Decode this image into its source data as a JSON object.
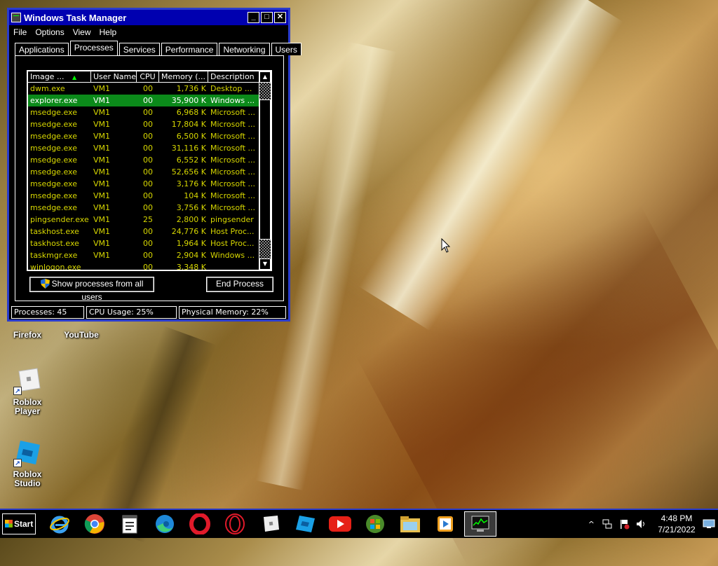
{
  "window": {
    "title": "Windows Task Manager",
    "caption_buttons": {
      "minimize": "_",
      "maximize": "□",
      "close": "✕"
    },
    "menu": [
      "File",
      "Options",
      "View",
      "Help"
    ],
    "tabs": [
      "Applications",
      "Processes",
      "Services",
      "Performance",
      "Networking",
      "Users"
    ],
    "active_tab": "Processes"
  },
  "process_table": {
    "columns": [
      "Image ...",
      "User Name",
      "CPU",
      "Memory (...",
      "Description"
    ],
    "sorted_column": "Image ...",
    "rows": [
      [
        "dwm.exe",
        "VM1",
        "00",
        "1,736 K",
        "Desktop ..."
      ],
      [
        "explorer.exe",
        "VM1",
        "00",
        "35,900 K",
        "Windows ..."
      ],
      [
        "msedge.exe",
        "VM1",
        "00",
        "6,968 K",
        "Microsoft ..."
      ],
      [
        "msedge.exe",
        "VM1",
        "00",
        "17,804 K",
        "Microsoft ..."
      ],
      [
        "msedge.exe",
        "VM1",
        "00",
        "6,500 K",
        "Microsoft ..."
      ],
      [
        "msedge.exe",
        "VM1",
        "00",
        "31,116 K",
        "Microsoft ..."
      ],
      [
        "msedge.exe",
        "VM1",
        "00",
        "6,552 K",
        "Microsoft ..."
      ],
      [
        "msedge.exe",
        "VM1",
        "00",
        "52,656 K",
        "Microsoft ..."
      ],
      [
        "msedge.exe",
        "VM1",
        "00",
        "3,176 K",
        "Microsoft ..."
      ],
      [
        "msedge.exe",
        "VM1",
        "00",
        "104 K",
        "Microsoft ..."
      ],
      [
        "msedge.exe",
        "VM1",
        "00",
        "3,756 K",
        "Microsoft ..."
      ],
      [
        "pingsender.exe",
        "VM1",
        "25",
        "2,800 K",
        "pingsender"
      ],
      [
        "taskhost.exe",
        "VM1",
        "00",
        "24,776 K",
        "Host Proc..."
      ],
      [
        "taskhost.exe",
        "VM1",
        "00",
        "1,964 K",
        "Host Proc..."
      ],
      [
        "taskmgr.exe",
        "VM1",
        "00",
        "2,904 K",
        "Windows ..."
      ],
      [
        "winlogon.exe",
        "",
        "00",
        "3,348 K",
        ""
      ]
    ],
    "selected_row": "explorer.exe"
  },
  "buttons": {
    "show_all": "Show processes from all users",
    "end_process": "End Process"
  },
  "status": {
    "processes": "Processes: 45",
    "cpu": "CPU Usage: 25%",
    "memory": "Physical Memory: 22%"
  },
  "desktop_icons": [
    {
      "label": "Firefox"
    },
    {
      "label": "YouTube"
    },
    {
      "label": "Roblox Player"
    },
    {
      "label": "Roblox Studio"
    }
  ],
  "taskbar": {
    "start_label": "Start",
    "pinned": [
      "internet-explorer-icon",
      "chrome-icon",
      "notepad-icon",
      "edge-icon",
      "opera-icon",
      "opera-gx-icon",
      "roblox-player-icon",
      "roblox-studio-icon",
      "youtube-icon",
      "windows-update-icon",
      "file-explorer-icon",
      "media-player-icon",
      "task-manager-icon"
    ],
    "clock_time": "4:48 PM",
    "clock_date": "7/21/2022"
  },
  "colors": {
    "window_border": "#2a3ccc",
    "title_bar": "#0000b0",
    "process_text": "#d7d700",
    "selected_row": "#0b8a1a"
  }
}
